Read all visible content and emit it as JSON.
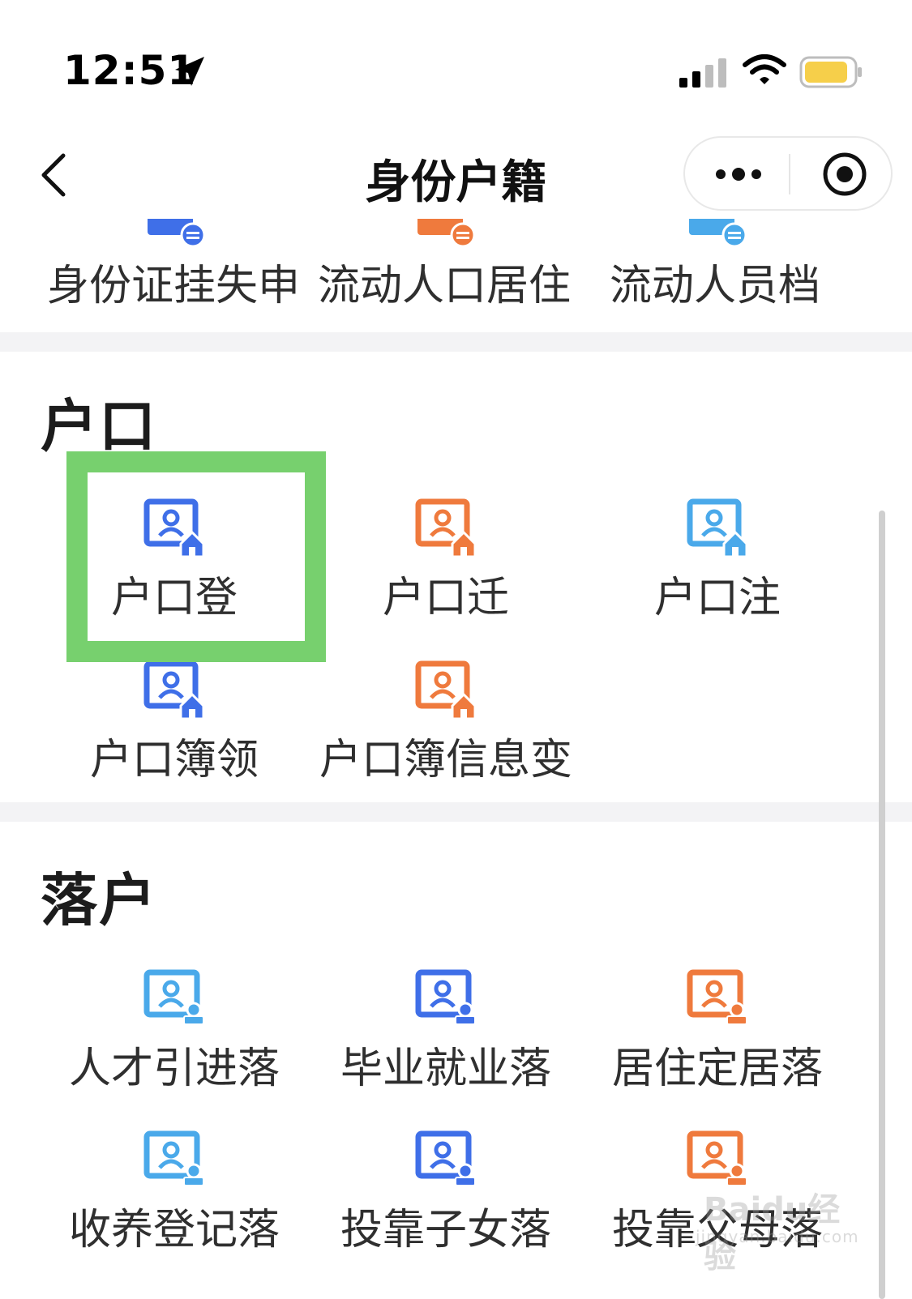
{
  "status_bar": {
    "time": "12:51",
    "icons": [
      "location-arrow-icon",
      "signal-icon",
      "wifi-icon",
      "battery-icon"
    ],
    "battery_color": "#f6cf4a"
  },
  "nav": {
    "title": "身份户籍",
    "back_icon": "chevron-left-icon",
    "more_icon": "more-dots-icon",
    "close_icon": "target-close-icon"
  },
  "top_row": {
    "items": [
      {
        "label": "身份证挂失申",
        "color": "#3f6fe8"
      },
      {
        "label": "流动人口居住",
        "color": "#ef7a3d"
      },
      {
        "label": "流动人员档",
        "color": "#4aa9ea"
      }
    ]
  },
  "household": {
    "title": "户口",
    "items": [
      {
        "label": "户口登",
        "color": "#3f6fe8"
      },
      {
        "label": "户口迁",
        "color": "#ef7a3d"
      },
      {
        "label": "户口注",
        "color": "#4aa9ea"
      },
      {
        "label": "户口簿领",
        "color": "#3f6fe8"
      },
      {
        "label": "户口簿信息变",
        "color": "#ef7a3d"
      }
    ]
  },
  "settle": {
    "title": "落户",
    "items": [
      {
        "label": "人才引进落",
        "color": "#4aa9ea"
      },
      {
        "label": "毕业就业落",
        "color": "#3f6fe8"
      },
      {
        "label": "居住定居落",
        "color": "#ef7a3d"
      },
      {
        "label": "收养登记落",
        "color": "#4aa9ea"
      },
      {
        "label": "投靠子女落",
        "color": "#3f6fe8"
      },
      {
        "label": "投靠父母落",
        "color": "#ef7a3d"
      }
    ]
  },
  "highlight_color": "#77d06e",
  "watermark": {
    "text": "Baidu经验",
    "sub": "jingyan.baidu.com"
  }
}
